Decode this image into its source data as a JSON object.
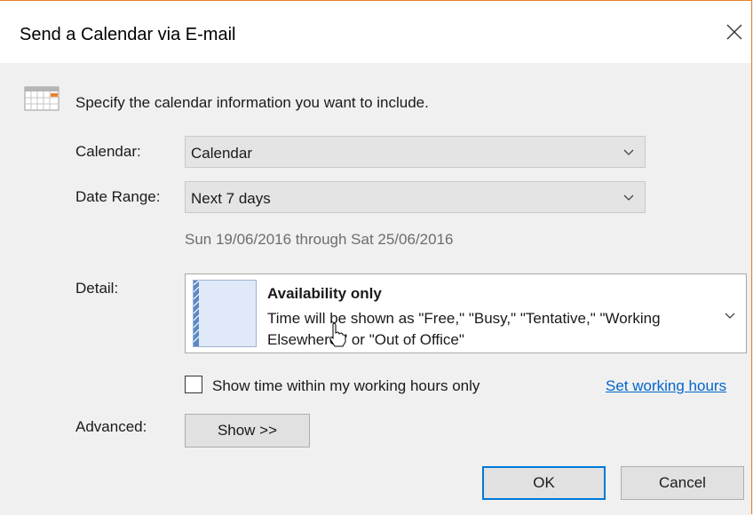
{
  "dialog": {
    "title": "Send a Calendar via E-mail",
    "intro": "Specify the calendar information you want to include."
  },
  "fields": {
    "calendar_label": "Calendar:",
    "calendar_value": "Calendar",
    "date_range_label": "Date Range:",
    "date_range_value": "Next 7 days",
    "date_range_text": "Sun 19/06/2016 through Sat 25/06/2016",
    "detail_label": "Detail:",
    "detail_title": "Availability only",
    "detail_desc": "Time will be shown as \"Free,\" \"Busy,\" \"Tentative,\" \"Working Elsewhere,\" or \"Out of Office\"",
    "working_hours_checkbox": "Show time within my working hours only",
    "working_hours_checked": false,
    "set_working_hours_link": "Set working hours",
    "advanced_label": "Advanced:",
    "advanced_button": "Show >>"
  },
  "buttons": {
    "ok": "OK",
    "cancel": "Cancel"
  },
  "colors": {
    "accent_border": "#e8822b",
    "link": "#0066cc",
    "default_button_border": "#0078d7"
  }
}
